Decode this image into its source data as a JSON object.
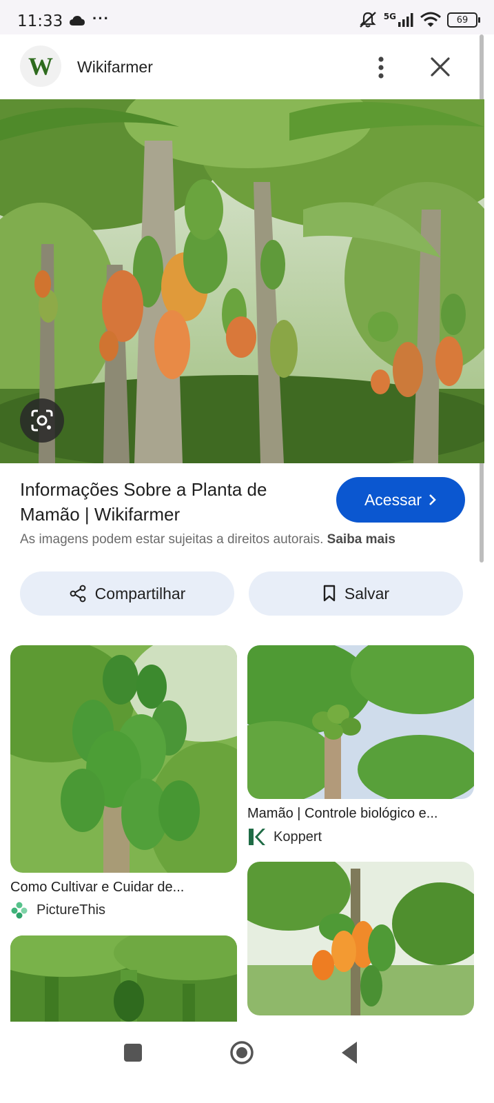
{
  "status_bar": {
    "time": "11:33",
    "network": "5G",
    "battery": "69",
    "cloud_icon": "cloud-icon",
    "more_icon": "more-dots-icon"
  },
  "header": {
    "logo_letter": "W",
    "site_name": "Wikifarmer",
    "menu_icon": "more-vert-icon",
    "close_icon": "close-icon"
  },
  "result": {
    "title": "Informações Sobre a Planta de Mamão | Wikifarmer",
    "visit_label": "Acessar",
    "copyright_text": "As imagens podem estar sujeitas a direitos autorais.",
    "learn_more": "Saiba mais",
    "share_label": "Compartilhar",
    "save_label": "Salvar"
  },
  "related": [
    {
      "title": "Como Cultivar e Cuidar de...",
      "source": "PictureThis"
    },
    {
      "title": "Mamão | Controle biológico e...",
      "source": "Koppert"
    }
  ],
  "colors": {
    "accent": "#0b57d0",
    "pill_bg": "#e8eef8",
    "logo_green": "#2e6b1e",
    "koppert_green": "#1f6b45"
  }
}
